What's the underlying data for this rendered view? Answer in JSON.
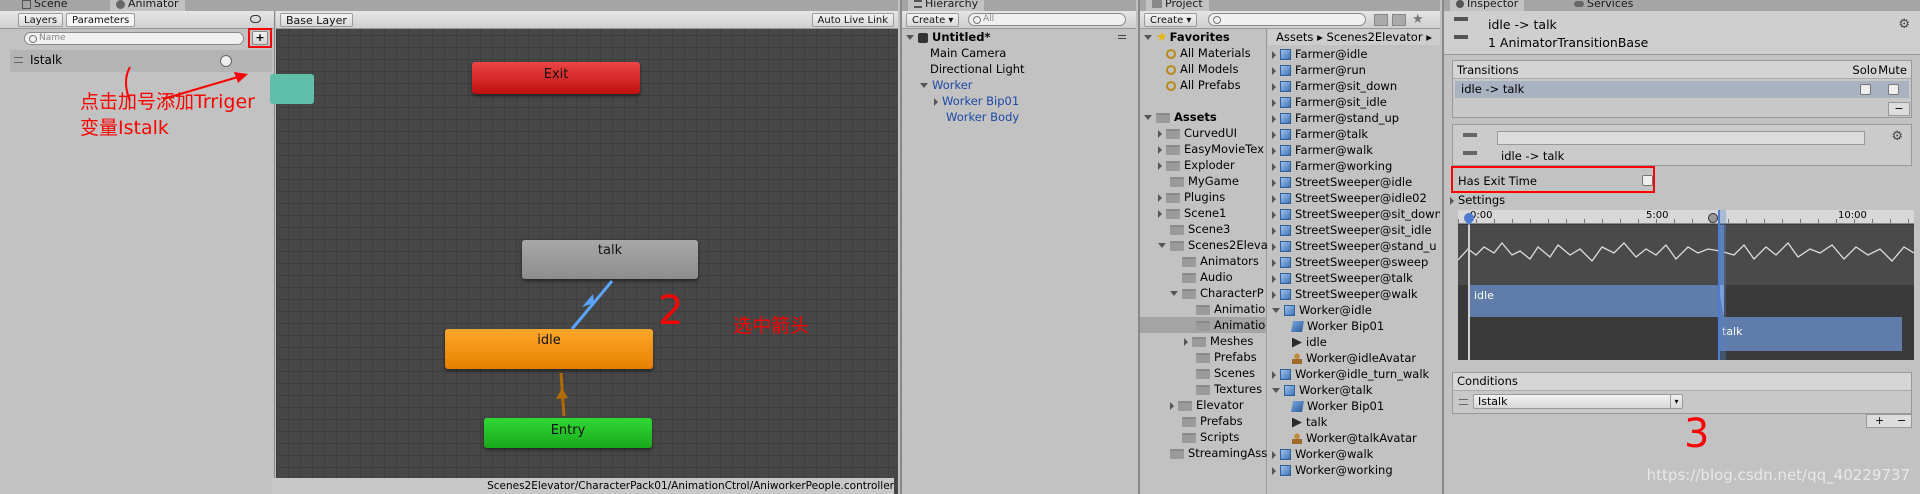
{
  "animator": {
    "tabs": {
      "scene": "Scene",
      "animator": "Animator"
    },
    "left_tabs": {
      "layers": "Layers",
      "parameters": "Parameters"
    },
    "search_placeholder": "Name",
    "add_button": "+",
    "parameter_name": "Istalk",
    "annotation_1": "点击加号添加Trriger\n变量Istalk",
    "breadcrumb": "Base Layer",
    "auto_live_link": "Auto Live Link",
    "nodes": {
      "exit": "Exit",
      "talk": "talk",
      "idle": "idle",
      "entry": "Entry"
    },
    "annotation_2_number": "2",
    "annotation_2_text": "选中箭头",
    "footer_path": "Scenes2Elevator/CharacterPack01/AnimationCtrol/AniworkerPeople.controller"
  },
  "hierarchy": {
    "tab": "Hierarchy",
    "create": "Create",
    "search_placeholder": "All",
    "scene": "Untitled*",
    "items": [
      "Main Camera",
      "Directional Light",
      "Worker",
      "Worker Bip01",
      "Worker Body"
    ]
  },
  "project": {
    "tab": "Project",
    "create": "Create",
    "favorites": "Favorites",
    "fav_items": [
      "All Materials",
      "All Models",
      "All Prefabs"
    ],
    "assets": "Assets",
    "folders": [
      "CurvedUI",
      "EasyMovieTex",
      "Exploder",
      "MyGame",
      "Plugins",
      "Scene1",
      "Scene3",
      "Scenes2Eleva",
      "Animators",
      "Audio",
      "CharacterP",
      "Animatio",
      "Animatio",
      "Meshes",
      "Prefabs",
      "Scenes",
      "Textures",
      "Elevator",
      "Prefabs",
      "Scripts",
      "StreamingAss"
    ],
    "breadcrumb": [
      "Assets",
      "Scenes2Elevator"
    ],
    "files": [
      "Farmer@idle",
      "Farmer@run",
      "Farmer@sit_down",
      "Farmer@sit_idle",
      "Farmer@stand_up",
      "Farmer@talk",
      "Farmer@walk",
      "Farmer@working",
      "StreetSweeper@idle",
      "StreetSweeper@idle02",
      "StreetSweeper@sit_down",
      "StreetSweeper@sit_idle",
      "StreetSweeper@stand_u",
      "StreetSweeper@sweep",
      "StreetSweeper@talk",
      "StreetSweeper@walk",
      "Worker@idle",
      "Worker Bip01",
      "idle",
      "Worker@idleAvatar",
      "Worker@idle_turn_walk",
      "Worker@talk",
      "Worker Bip01",
      "talk",
      "Worker@talkAvatar",
      "Worker@walk",
      "Worker@working"
    ]
  },
  "inspector": {
    "tabs": {
      "inspector": "Inspector",
      "services": "Services"
    },
    "title": "idle -> talk",
    "subtitle": "1 AnimatorTransitionBase",
    "transitions_label": "Transitions",
    "solo": "Solo",
    "mute": "Mute",
    "transition_row": "idle -> talk",
    "minus": "−",
    "plus": "+",
    "transition_name": "idle -> talk",
    "has_exit_time": "Has Exit Time",
    "settings": "Settings",
    "timeline_labels": [
      "0:00",
      "5:00",
      "10:00"
    ],
    "clip_idle": "idle",
    "clip_talk": "talk",
    "conditions_label": "Conditions",
    "condition_param": "Istalk",
    "annotation_3": "3",
    "watermark": "https://blog.csdn.net/qq_40229737"
  }
}
